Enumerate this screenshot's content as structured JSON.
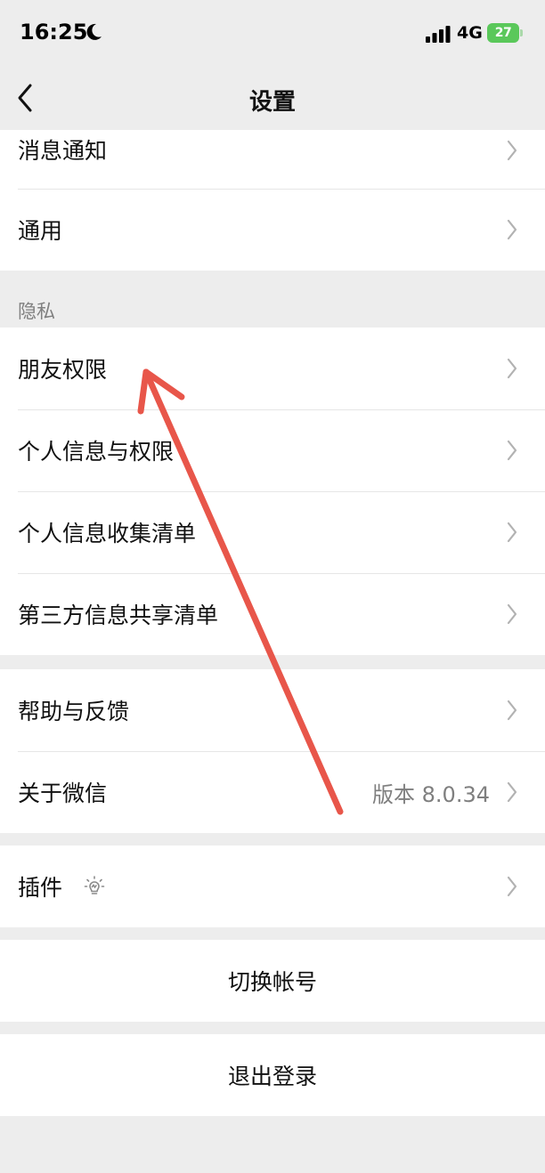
{
  "status": {
    "time": "16:25",
    "network": "4G",
    "battery_level": "27"
  },
  "nav": {
    "title": "设置"
  },
  "group_top": {
    "items": [
      {
        "label": "消息通知"
      },
      {
        "label": "通用"
      }
    ]
  },
  "privacy": {
    "header": "隐私",
    "items": [
      {
        "label": "朋友权限"
      },
      {
        "label": "个人信息与权限"
      },
      {
        "label": "个人信息收集清单"
      },
      {
        "label": "第三方信息共享清单"
      }
    ]
  },
  "about_group": {
    "items": [
      {
        "label": "帮助与反馈"
      },
      {
        "label": "关于微信",
        "value": "版本 8.0.34"
      }
    ]
  },
  "plugins": {
    "label": "插件",
    "icon": "lightbulb-icon"
  },
  "actions": {
    "switch_account": "切换帐号",
    "logout": "退出登录"
  },
  "colors": {
    "background": "#ededed",
    "cell": "#ffffff",
    "annotation_arrow": "#e8564a",
    "battery": "#5ac85a"
  }
}
